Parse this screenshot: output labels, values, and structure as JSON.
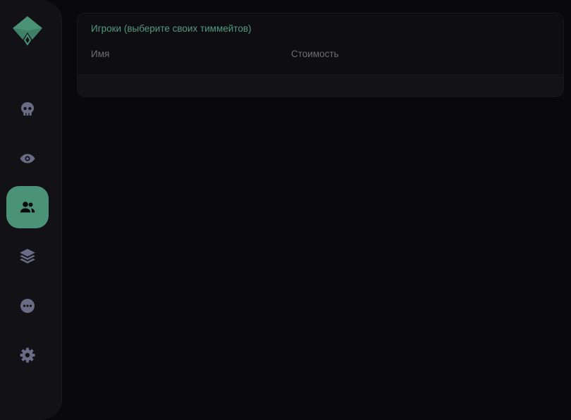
{
  "colors": {
    "accent": "#4b9378",
    "accent_text": "#4f9a7f",
    "icon_muted": "#6a6c85",
    "sidebar_bg": "#121216",
    "page_bg": "#09090b"
  },
  "sidebar": {
    "logo_icon": "diamond-logo-icon",
    "items": [
      {
        "id": "skull",
        "icon": "skull-icon",
        "active": false
      },
      {
        "id": "eye",
        "icon": "eye-icon",
        "active": false
      },
      {
        "id": "users",
        "icon": "users-icon",
        "active": true
      },
      {
        "id": "layers",
        "icon": "layers-icon",
        "active": false
      },
      {
        "id": "more",
        "icon": "more-icon",
        "active": false
      },
      {
        "id": "settings",
        "icon": "gear-icon",
        "active": false
      }
    ]
  },
  "players_panel": {
    "title": "Игроки (выберите своих тиммейтов)",
    "columns": [
      "Имя",
      "Стоимость"
    ],
    "rows": []
  }
}
